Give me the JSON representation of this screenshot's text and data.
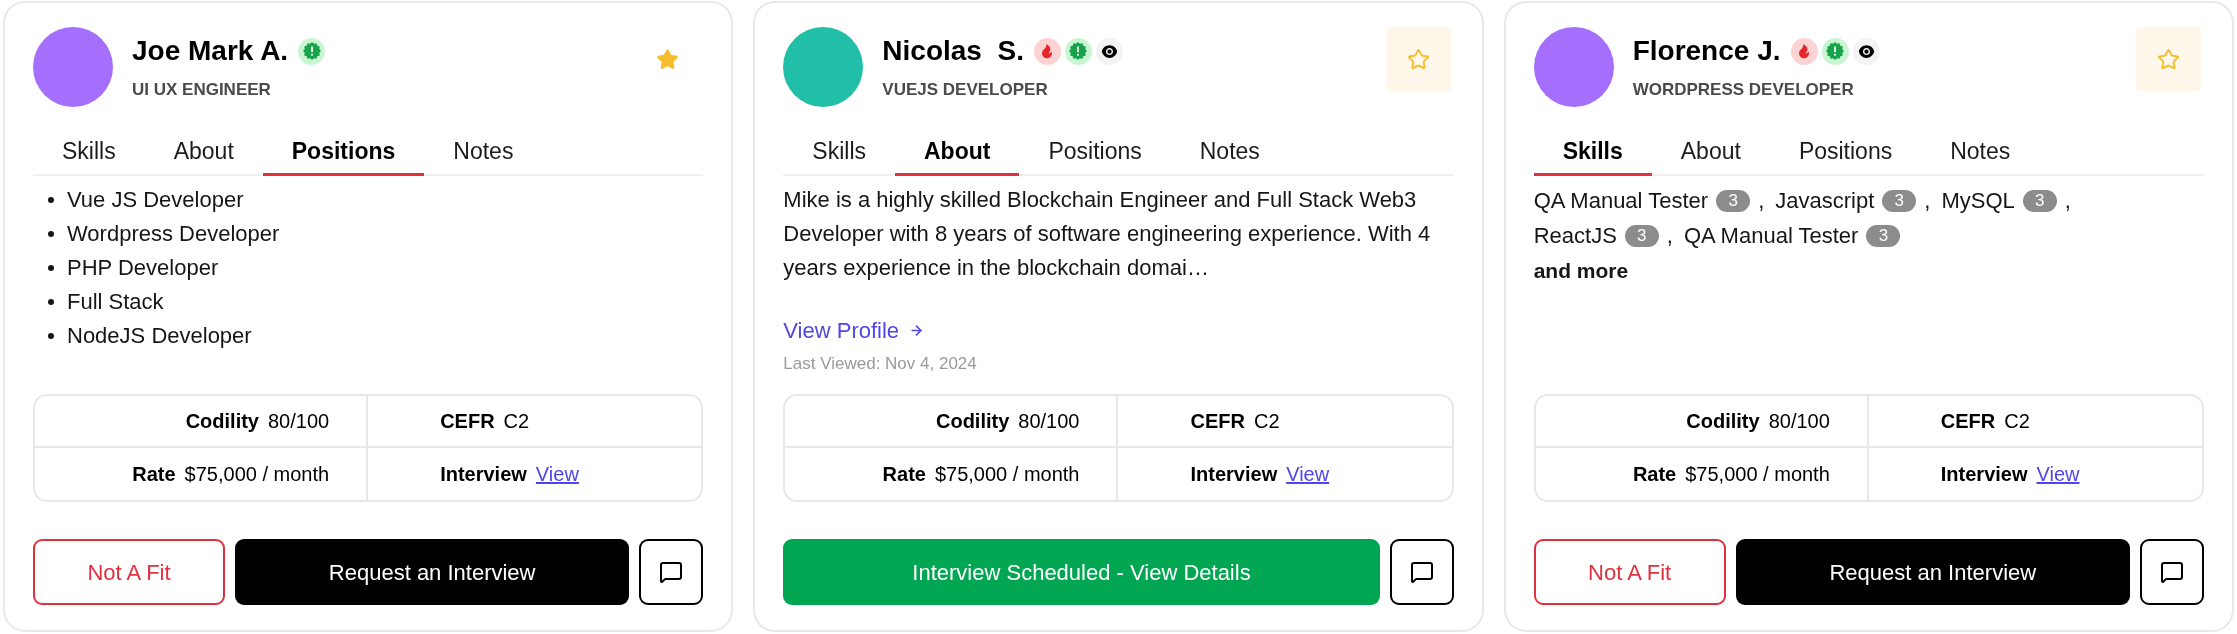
{
  "cards": [
    {
      "avatar": {
        "color": "#a66efc"
      },
      "name": "Joe Mark A.",
      "badges": [
        {
          "kind": "verified"
        }
      ],
      "role": "UI UX ENGINEER",
      "starred": true,
      "tabs": [
        {
          "label": "Skills",
          "selected": false
        },
        {
          "label": "About",
          "selected": false
        },
        {
          "label": "Positions",
          "selected": true
        },
        {
          "label": "Notes",
          "selected": false
        }
      ],
      "content": {
        "kind": "positions",
        "items": [
          "Vue JS Developer",
          "Wordpress Developer",
          "PHP Developer",
          "Full Stack",
          "NodeJS Developer"
        ]
      },
      "stats": [
        {
          "label": "Codility",
          "kind": "text",
          "value": "80/100"
        },
        {
          "label": "CEFR",
          "kind": "text",
          "value": "C2"
        },
        {
          "label": "Rate",
          "kind": "text",
          "value": "$75,000 / month"
        },
        {
          "label": "Interview",
          "kind": "link",
          "value": "View"
        }
      ],
      "actions": [
        {
          "kind": "outline",
          "label": "Not A Fit"
        },
        {
          "kind": "primary",
          "label": "Request an Interview"
        },
        {
          "kind": "chat"
        }
      ]
    },
    {
      "avatar": {
        "color": "#22bfa8"
      },
      "name": "Nicolas  S.",
      "badges": [
        {
          "kind": "hot"
        },
        {
          "kind": "verified"
        },
        {
          "kind": "viewed"
        }
      ],
      "role": "VUEJS DEVELOPER",
      "starred": false,
      "tabs": [
        {
          "label": "Skills",
          "selected": false
        },
        {
          "label": "About",
          "selected": true
        },
        {
          "label": "Positions",
          "selected": false
        },
        {
          "label": "Notes",
          "selected": false
        }
      ],
      "content": {
        "kind": "about",
        "text": "Mike is a highly skilled Blockchain Engineer and Full Stack Web3 Developer with 8 years of software engineering experience. With 4 years experience in the blockchain domai…",
        "link": "View Profile",
        "last_viewed": "Last Viewed: Nov 4, 2024"
      },
      "stats": [
        {
          "label": "Codility",
          "kind": "text",
          "value": "80/100"
        },
        {
          "label": "CEFR",
          "kind": "text",
          "value": "C2"
        },
        {
          "label": "Rate",
          "kind": "text",
          "value": "$75,000 / month"
        },
        {
          "label": "Interview",
          "kind": "link",
          "value": "View"
        }
      ],
      "actions": [
        {
          "kind": "success",
          "label": "Interview Scheduled - View Details"
        },
        {
          "kind": "chat"
        }
      ]
    },
    {
      "avatar": {
        "color": "#a66efc"
      },
      "name": "Florence J.",
      "badges": [
        {
          "kind": "hot"
        },
        {
          "kind": "verified"
        },
        {
          "kind": "viewed"
        }
      ],
      "role": "WORDPRESS DEVELOPER",
      "starred": false,
      "tabs": [
        {
          "label": "Skills",
          "selected": true
        },
        {
          "label": "About",
          "selected": false
        },
        {
          "label": "Positions",
          "selected": false
        },
        {
          "label": "Notes",
          "selected": false
        }
      ],
      "content": {
        "kind": "skills",
        "items": [
          {
            "name": "QA Manual Tester",
            "count": "3",
            "separator": ","
          },
          {
            "name": "Javascript",
            "count": "3",
            "separator": ","
          },
          {
            "name": "MySQL",
            "count": "3",
            "separator": ","
          },
          {
            "name": "ReactJS",
            "count": "3",
            "separator": ","
          },
          {
            "name": "QA Manual Tester",
            "count": "3"
          }
        ],
        "more": "and more"
      },
      "stats": [
        {
          "label": "Codility",
          "kind": "text",
          "value": "80/100"
        },
        {
          "label": "CEFR",
          "kind": "text",
          "value": "C2"
        },
        {
          "label": "Rate",
          "kind": "text",
          "value": "$75,000 / month"
        },
        {
          "label": "Interview",
          "kind": "link",
          "value": "View"
        }
      ],
      "actions": [
        {
          "kind": "outline",
          "label": "Not A Fit"
        },
        {
          "kind": "primary",
          "label": "Request an Interview"
        },
        {
          "kind": "chat"
        }
      ]
    }
  ]
}
